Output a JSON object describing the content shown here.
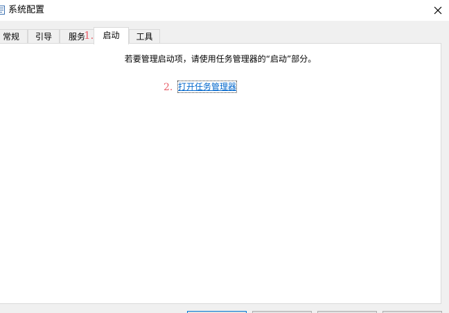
{
  "window": {
    "title": "系统配置",
    "icon": "msconfig-icon",
    "close_glyph": "✕"
  },
  "tabs": [
    {
      "label": "常规",
      "active": false
    },
    {
      "label": "引导",
      "active": false
    },
    {
      "label": "服务",
      "active": false
    },
    {
      "label": "启动",
      "active": true
    },
    {
      "label": "工具",
      "active": false
    }
  ],
  "annotations": {
    "step1": "1.",
    "step2": "2."
  },
  "startup_panel": {
    "message": "若要管理启动项，请使用任务管理器的“启动”部分。",
    "link": "打开任务管理器"
  },
  "colors": {
    "annotation": "#e8606a",
    "link": "#0066cc",
    "panel_background": "#ffffff",
    "dialog_background": "#f0f0f0",
    "primary_button_border": "#0078d7"
  }
}
